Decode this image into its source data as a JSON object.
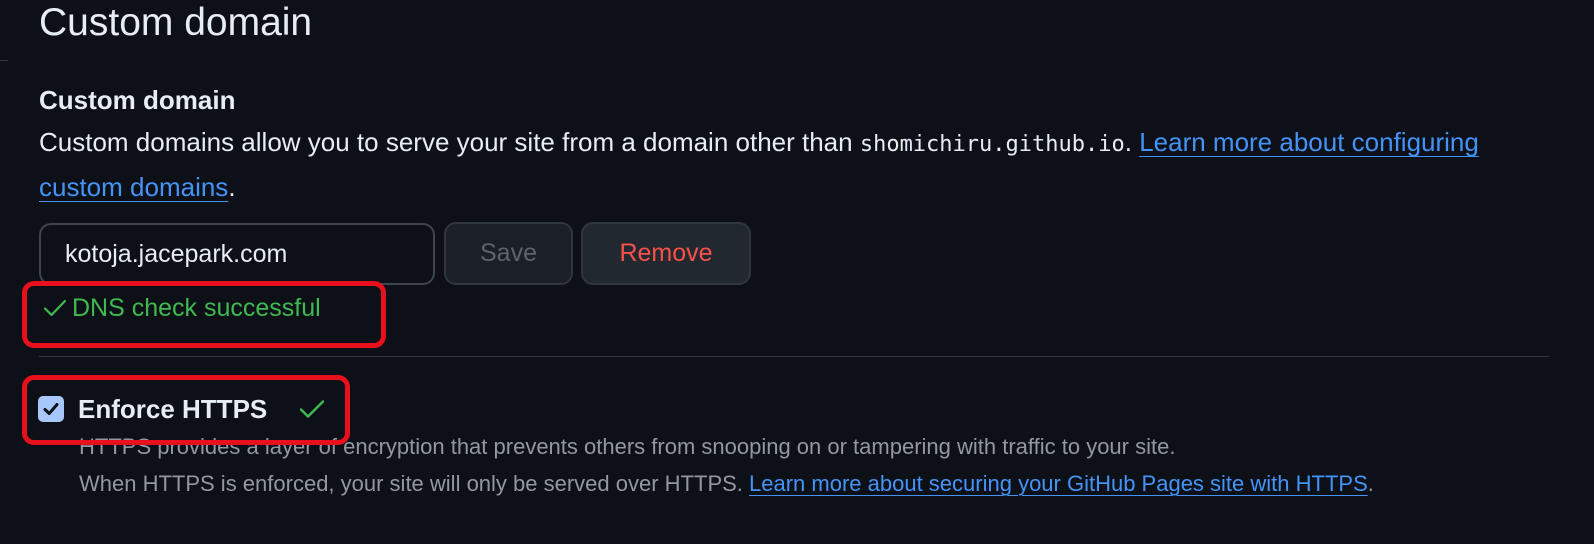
{
  "page": {
    "title": "Custom domain"
  },
  "custom_domain": {
    "heading": "Custom domain",
    "description_prefix": "Custom domains allow you to serve your site from a domain other than ",
    "default_domain": "shomichiru.github.io",
    "description_sep": ". ",
    "learn_more_link": "Learn more about configuring custom domains",
    "description_suffix": ".",
    "input_value": "kotoja.jacepark.com",
    "save_label": "Save",
    "remove_label": "Remove",
    "dns_status": "DNS check successful"
  },
  "https": {
    "label": "Enforce HTTPS",
    "checked": true,
    "description_line1": "HTTPS provides a layer of encryption that prevents others from snooping on or tampering with traffic to your site.",
    "description_line2": "When HTTPS is enforced, your site will only be served over HTTPS. ",
    "learn_more_link": "Learn more about securing your GitHub Pages site with HTTPS",
    "description_suffix": "."
  },
  "icons": {
    "dns_status_icon": "check-icon",
    "https_status_icon": "check-icon",
    "checkbox_icon": "checkmark-icon"
  },
  "colors": {
    "background": "#0d1117",
    "text": "#e6edf3",
    "muted_text": "#9198a1",
    "link": "#4493f8",
    "success": "#3fb950",
    "danger": "#f85149",
    "annotation": "#e8101c",
    "checkbox": "#a8c7fa"
  }
}
